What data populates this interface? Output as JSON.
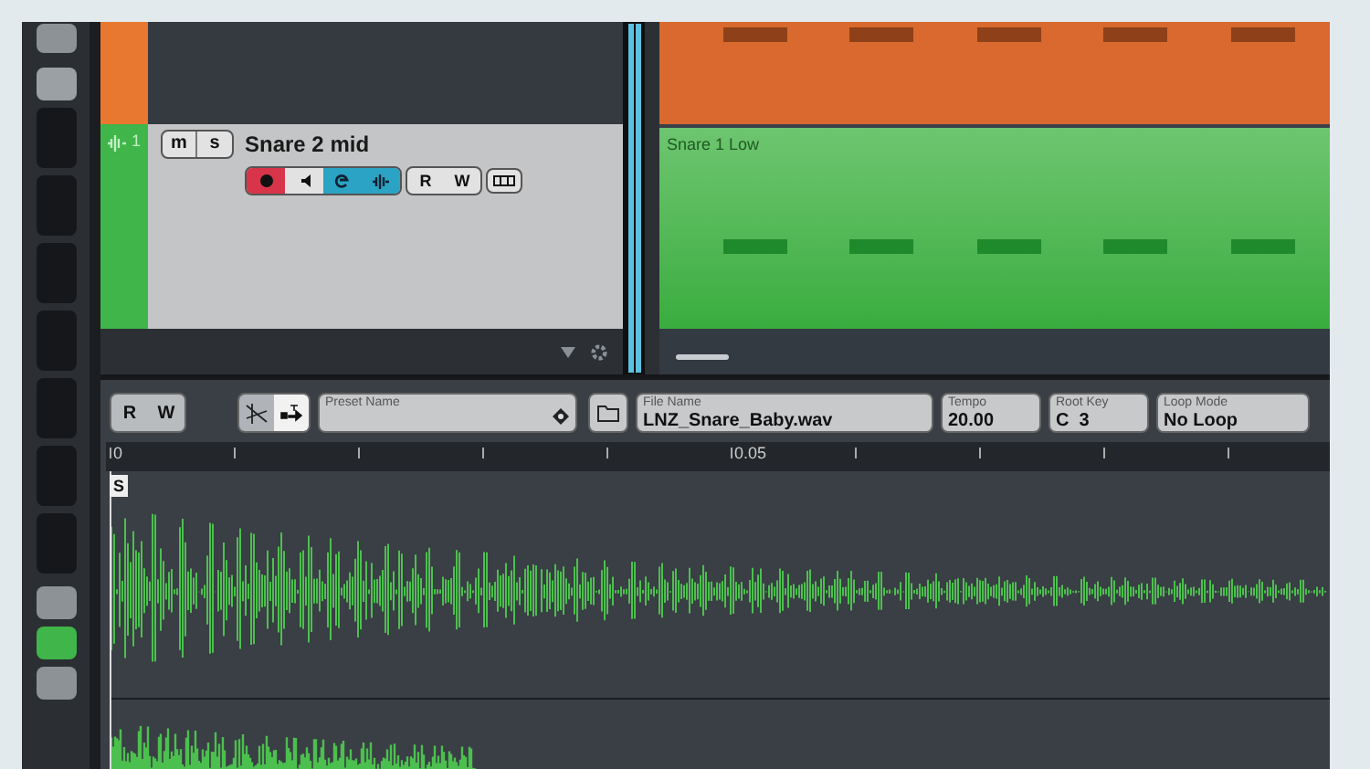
{
  "track": {
    "number": "1",
    "name": "Snare 2  mid",
    "color": "#3fb54a",
    "toggles": [
      {
        "label": "m"
      },
      {
        "label": "s"
      }
    ],
    "controls": [
      {
        "kind": "record",
        "on": true
      },
      {
        "kind": "monitor",
        "on": false
      },
      {
        "kind": "edit",
        "on": true
      },
      {
        "kind": "channel",
        "on": true
      }
    ],
    "automation": [
      {
        "label": "R"
      },
      {
        "label": "W"
      }
    ]
  },
  "upper_track": {
    "color": "#e8782f"
  },
  "arrange": {
    "clip_label": "Snare 1 Low"
  },
  "editor": {
    "automation": [
      {
        "label": "R"
      },
      {
        "label": "W"
      }
    ],
    "preset": {
      "label": "Preset Name"
    },
    "file": {
      "label": "File Name",
      "value": "LNZ_Snare_Baby.wav"
    },
    "fields": [
      {
        "label": "Tempo",
        "value": "20.00"
      },
      {
        "label": "Root Key",
        "value": "C  3"
      },
      {
        "label": "Loop Mode",
        "value": "No Loop"
      }
    ],
    "ruler": [
      "0",
      "0.05"
    ],
    "start_marker": "S"
  }
}
